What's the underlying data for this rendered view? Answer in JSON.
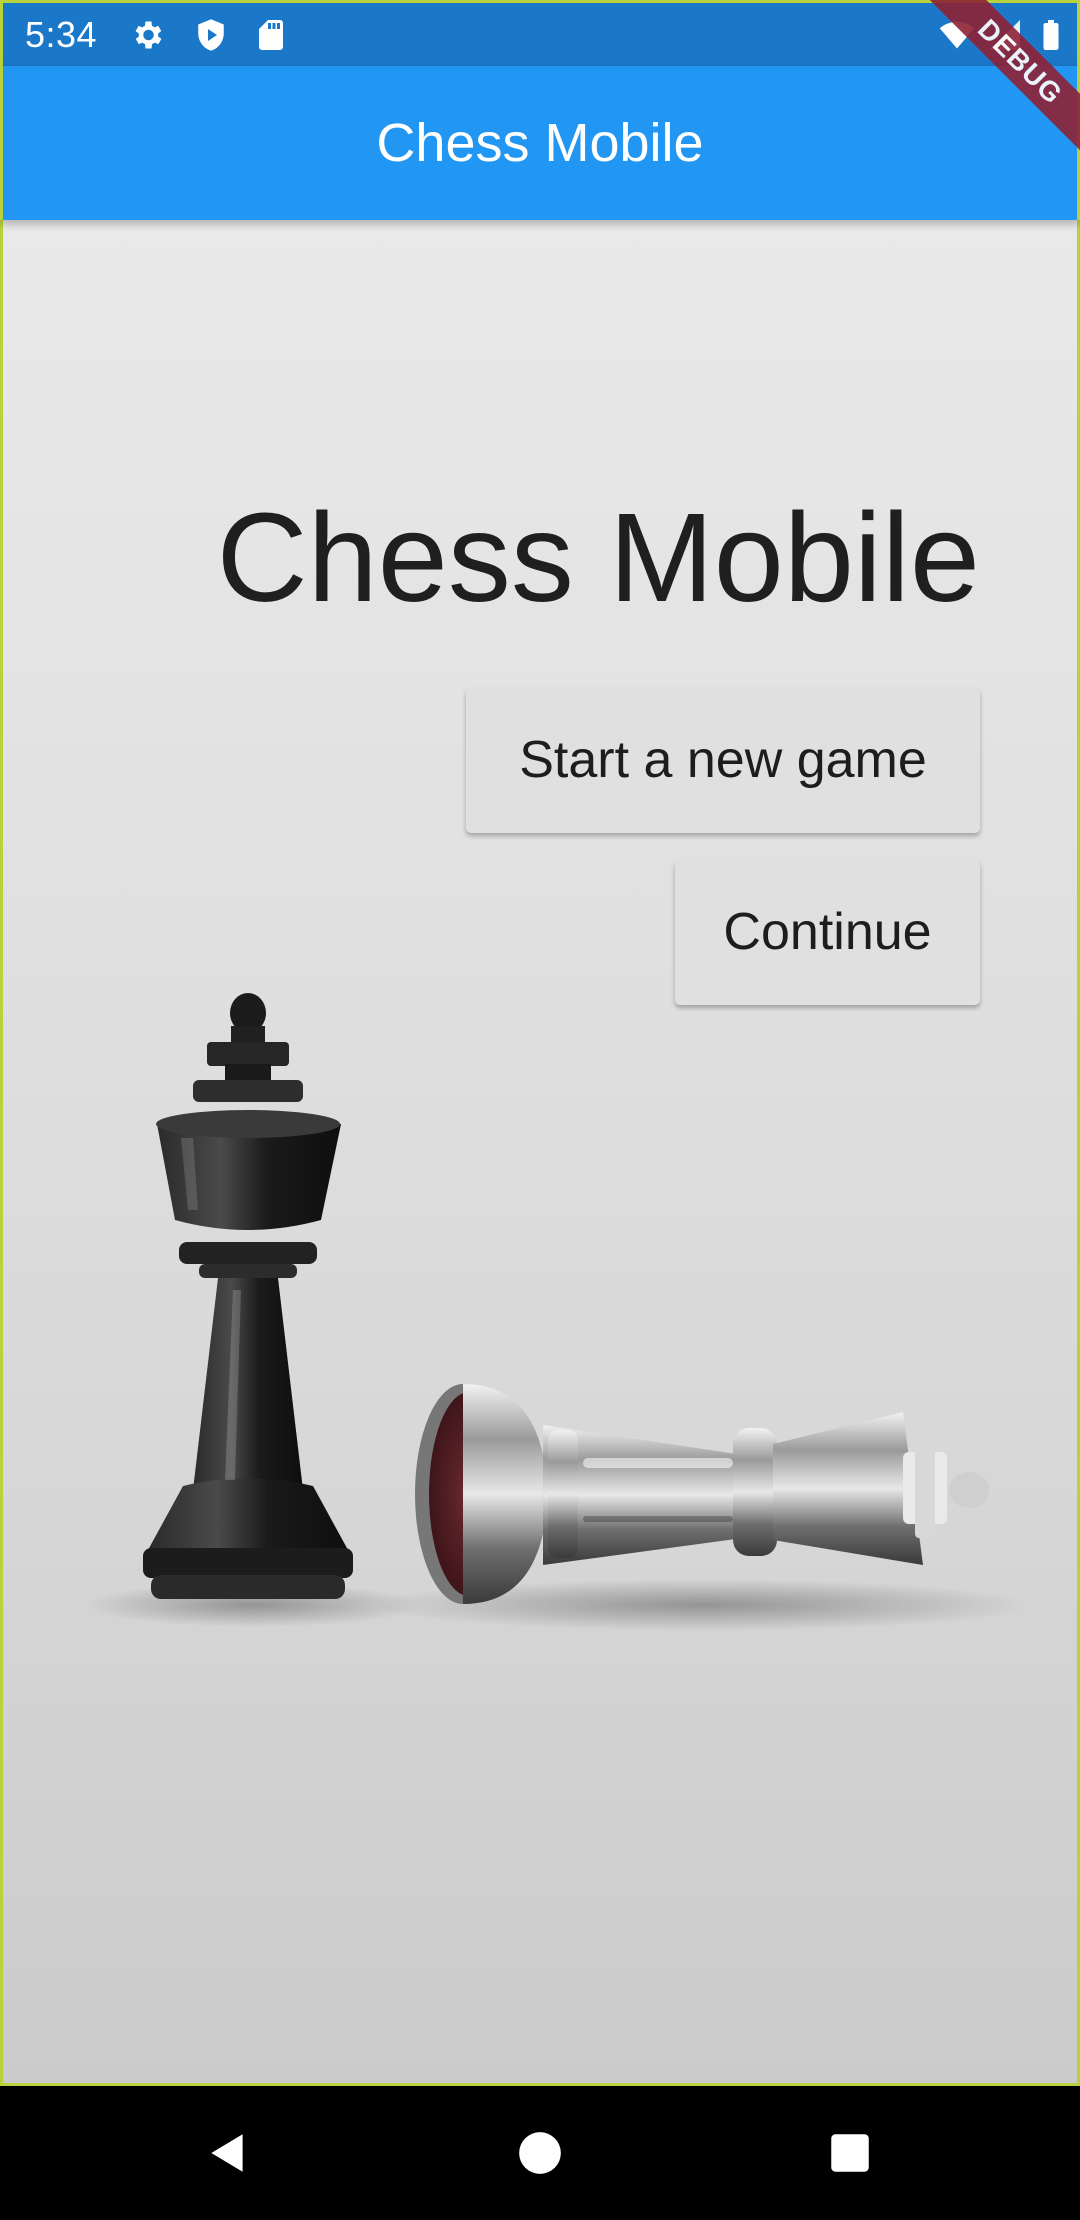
{
  "status_bar": {
    "time": "5:34",
    "left_icons": [
      "settings-gear-icon",
      "play-protect-icon",
      "sd-card-icon"
    ],
    "right_icons": [
      "wifi-icon",
      "cell-signal-icon",
      "battery-icon"
    ]
  },
  "debug_banner": "DEBUG",
  "app_bar": {
    "title": "Chess Mobile"
  },
  "main": {
    "title": "Chess Mobile",
    "buttons": {
      "new_game": "Start a new game",
      "continue": "Continue"
    }
  },
  "nav_bar": {
    "icons": [
      "back-icon",
      "home-icon",
      "recents-icon"
    ]
  },
  "colors": {
    "app_bar": "#2196f3",
    "status_bar": "#1b77c8",
    "button_bg": "#e0e0e0",
    "debug_ribbon": "#8e2236"
  }
}
